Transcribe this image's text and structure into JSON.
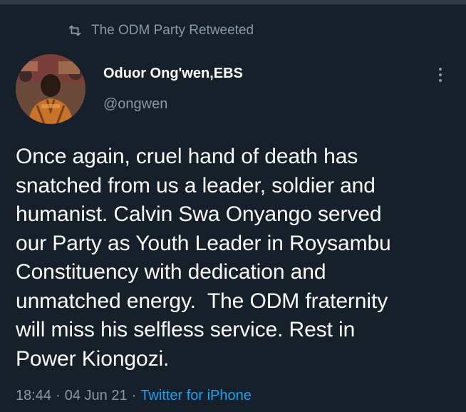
{
  "retweet": {
    "icon": "retweet-icon",
    "text": "The ODM Party Retweeted"
  },
  "author": {
    "display_name": "Oduor Ong'wen,EBS",
    "handle": "@ongwen",
    "avatar": "avatar-photo"
  },
  "tweet": {
    "text": "Once again, cruel hand of death has\nsnatched from us a leader, soldier and\nhumanist. Calvin Swa Onyango served\nour Party as Youth Leader in Roysambu\nConstituency with dedication and\nunmatched energy.  The ODM fraternity\nwill miss his selfless service. Rest in\nPower Kiongozi."
  },
  "meta": {
    "time": "18:44",
    "separator": "·",
    "date": "04 Jun 21",
    "source": "Twitter for iPhone"
  },
  "colors": {
    "background": "#15202b",
    "secondary_text": "#8899a6",
    "link": "#1da1f2"
  }
}
